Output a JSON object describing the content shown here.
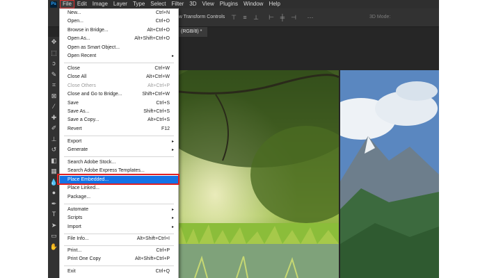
{
  "app": {
    "logo": "Ps",
    "menubar": [
      "File",
      "Edit",
      "Image",
      "Layer",
      "Type",
      "Select",
      "Filter",
      "3D",
      "View",
      "Plugins",
      "Window",
      "Help"
    ],
    "options_bar_text": "how Transform Controls",
    "options_bar_right": "3D Mode:",
    "doc_tab_label": "(RGB/8) *",
    "accent_color": "#1473e6",
    "callout_color": "#e02020"
  },
  "file_menu": {
    "items": [
      {
        "label": "New...",
        "shortcut": "Ctrl+N"
      },
      {
        "label": "Open...",
        "shortcut": "Ctrl+O"
      },
      {
        "label": "Browse in Bridge...",
        "shortcut": "Alt+Ctrl+O"
      },
      {
        "label": "Open As...",
        "shortcut": "Alt+Shift+Ctrl+O"
      },
      {
        "label": "Open as Smart Object...",
        "shortcut": ""
      },
      {
        "label": "Open Recent",
        "shortcut": ""
      },
      {
        "label": "Close",
        "shortcut": "Ctrl+W"
      },
      {
        "label": "Close All",
        "shortcut": "Alt+Ctrl+W"
      },
      {
        "label": "Close Others",
        "shortcut": "Alt+Ctrl+P"
      },
      {
        "label": "Close and Go to Bridge...",
        "shortcut": "Shift+Ctrl+W"
      },
      {
        "label": "Save",
        "shortcut": "Ctrl+S"
      },
      {
        "label": "Save As...",
        "shortcut": "Shift+Ctrl+S"
      },
      {
        "label": "Save a Copy...",
        "shortcut": "Alt+Ctrl+S"
      },
      {
        "label": "Revert",
        "shortcut": "F12"
      },
      {
        "label": "Export",
        "shortcut": ""
      },
      {
        "label": "Generate",
        "shortcut": ""
      },
      {
        "label": "Search Adobe Stock...",
        "shortcut": ""
      },
      {
        "label": "Search Adobe Express Templates...",
        "shortcut": ""
      },
      {
        "label": "Place Embedded...",
        "shortcut": ""
      },
      {
        "label": "Place Linked...",
        "shortcut": ""
      },
      {
        "label": "Package...",
        "shortcut": ""
      },
      {
        "label": "Automate",
        "shortcut": ""
      },
      {
        "label": "Scripts",
        "shortcut": ""
      },
      {
        "label": "Import",
        "shortcut": ""
      },
      {
        "label": "File Info...",
        "shortcut": "Alt+Shift+Ctrl+I"
      },
      {
        "label": "Print...",
        "shortcut": "Ctrl+P"
      },
      {
        "label": "Print One Copy",
        "shortcut": "Alt+Shift+Ctrl+P"
      },
      {
        "label": "Exit",
        "shortcut": "Ctrl+Q"
      }
    ],
    "submenu_arrow": "▸"
  }
}
